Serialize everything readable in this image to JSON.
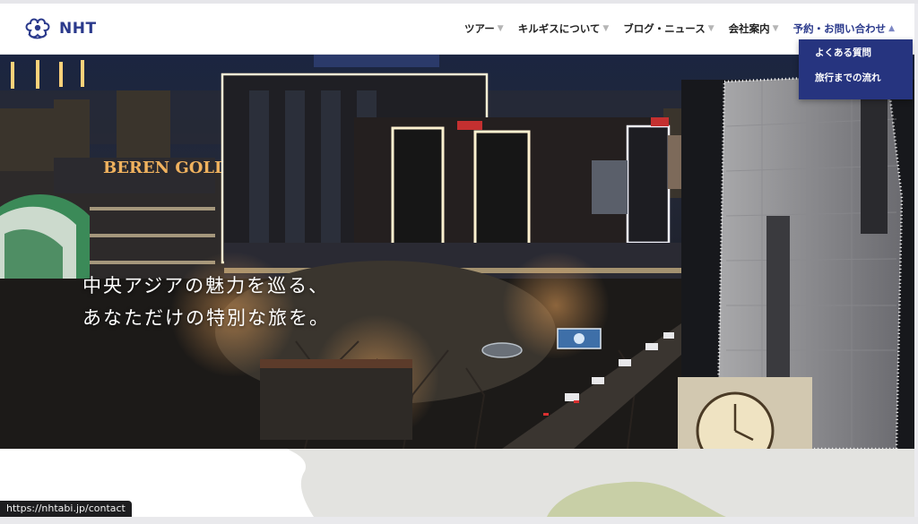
{
  "header": {
    "logo_text": "NHT",
    "nav": [
      {
        "label": "ツアー",
        "caret": "▼"
      },
      {
        "label": "キルギスについて",
        "caret": "▼"
      },
      {
        "label": "ブログ・ニュース",
        "caret": "▼"
      },
      {
        "label": "会社案内",
        "caret": "▼"
      },
      {
        "label": "予約・お問い合わせ",
        "caret": "▲"
      }
    ],
    "dropdown": [
      "よくある質問",
      "旅行までの流れ"
    ]
  },
  "hero": {
    "catch_line_1": "中央アジアの魅力を巡る、",
    "catch_line_2": "あなただけの特別な旅を。",
    "signage": "BEREN GOLD"
  },
  "status_url": "https://nhtabi.jp/contact",
  "colors": {
    "brand": "#2b3a8c",
    "dropdown_bg": "#26347f",
    "map_green": "#c8cfa6"
  },
  "icons": [
    "logo-icon",
    "caret-down-icon",
    "caret-up-icon"
  ]
}
